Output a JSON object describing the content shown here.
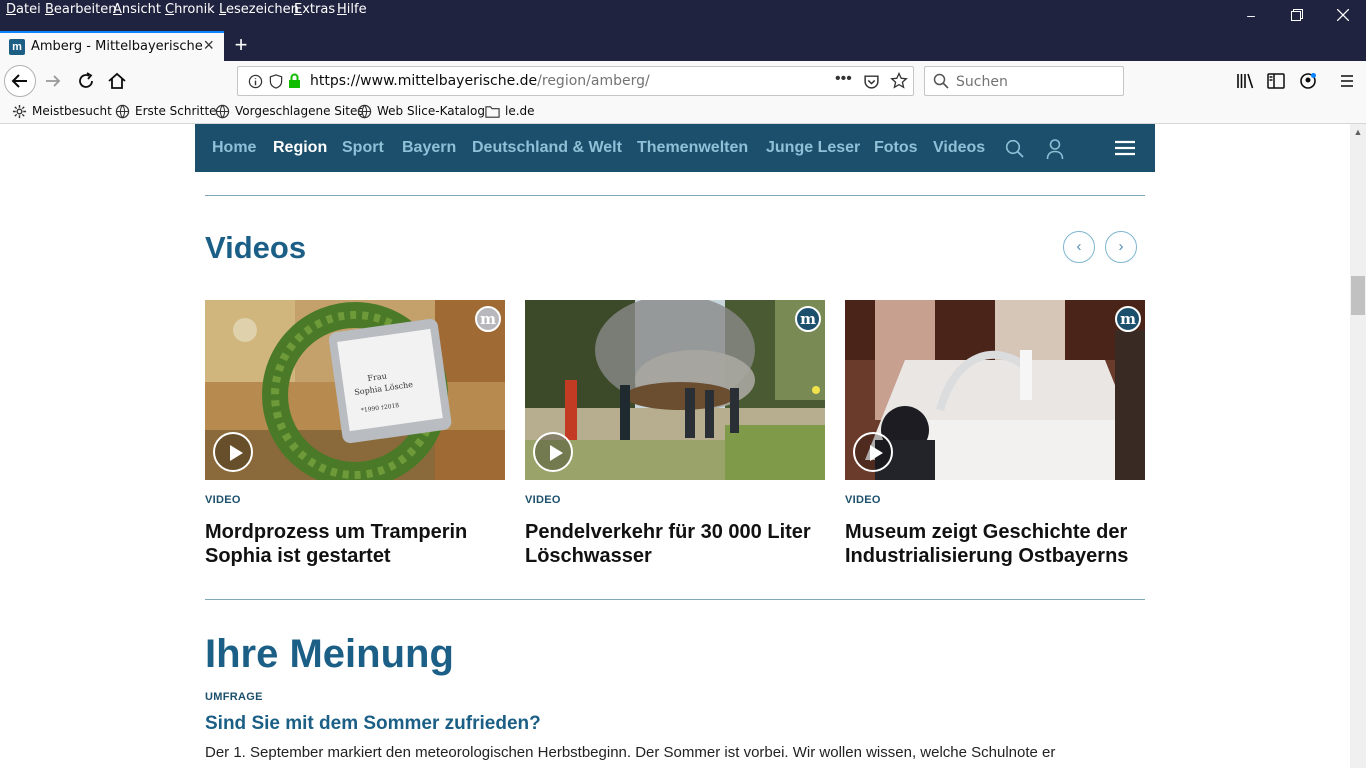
{
  "menubar": {
    "items": [
      "Datei",
      "Bearbeiten",
      "Ansicht",
      "Chronik",
      "Lesezeichen",
      "Extras",
      "Hilfe"
    ]
  },
  "tab": {
    "title": "Amberg - Mittelbayerische",
    "favicon": "m"
  },
  "urlbar": {
    "host": "https://www.mittelbayerische.de",
    "path": "/region/amberg/"
  },
  "searchbar": {
    "placeholder": "Suchen"
  },
  "bookmarks": [
    "Meistbesucht",
    "Erste Schritte",
    "Vorgeschlagene Sites",
    "Web Slice-Katalog",
    "le.de"
  ],
  "sitenav": {
    "items": [
      "Home",
      "Region",
      "Sport",
      "Bayern",
      "Deutschland & Welt",
      "Themenwelten",
      "Junge Leser",
      "Fotos",
      "Videos"
    ],
    "active": "Region"
  },
  "videos": {
    "title": "Videos",
    "cards": [
      {
        "kicker": "VIDEO",
        "title": "Mordprozess um Tramperin Sophia ist gestartet",
        "plaque": [
          "Frau",
          "Sophia Lösche",
          "*1990 †2018"
        ]
      },
      {
        "kicker": "VIDEO",
        "title": "Pendelverkehr für 30 000 Liter Löschwasser"
      },
      {
        "kicker": "VIDEO",
        "title": "Museum zeigt Geschichte der Industrialisierung Ostbayerns"
      }
    ]
  },
  "opinion": {
    "title": "Ihre Meinung",
    "kicker": "UMFRAGE",
    "question": "Sind Sie mit dem Sommer zufrieden?",
    "text": "Der 1. September markiert den meteorologischen Herbstbeginn. Der Sommer ist vorbei. Wir wollen wissen, welche Schulnote er"
  },
  "colors": {
    "nav_bg": "#1c4f6b",
    "accent": "#1b5f86",
    "chrome_dark": "#202340"
  }
}
